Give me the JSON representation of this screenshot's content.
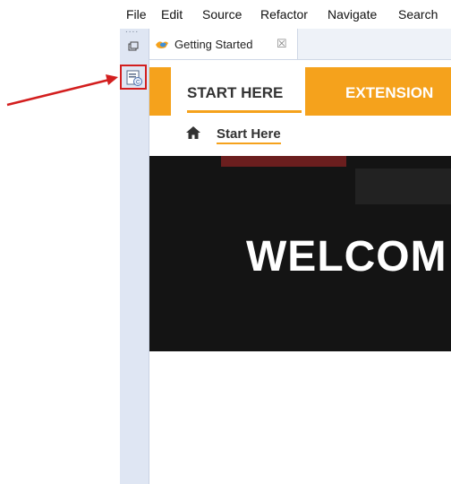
{
  "menu": [
    "File",
    "Edit",
    "Source",
    "Refactor",
    "Navigate",
    "Search"
  ],
  "editor_tab": {
    "label": "Getting Started",
    "close_glyph": "☒"
  },
  "welcome_tabs": {
    "start": "START HERE",
    "extensions": "EXTENSION"
  },
  "breadcrumb": {
    "label": "Start Here"
  },
  "hero": {
    "title": "WELCOM"
  },
  "colors": {
    "accent": "#f5a21c",
    "annotation": "#d31e1e",
    "hero_bg": "#141414"
  },
  "icons": [
    "restore-icon",
    "view-icon",
    "tab-logo-icon",
    "home-icon",
    "arrow-annotation"
  ]
}
